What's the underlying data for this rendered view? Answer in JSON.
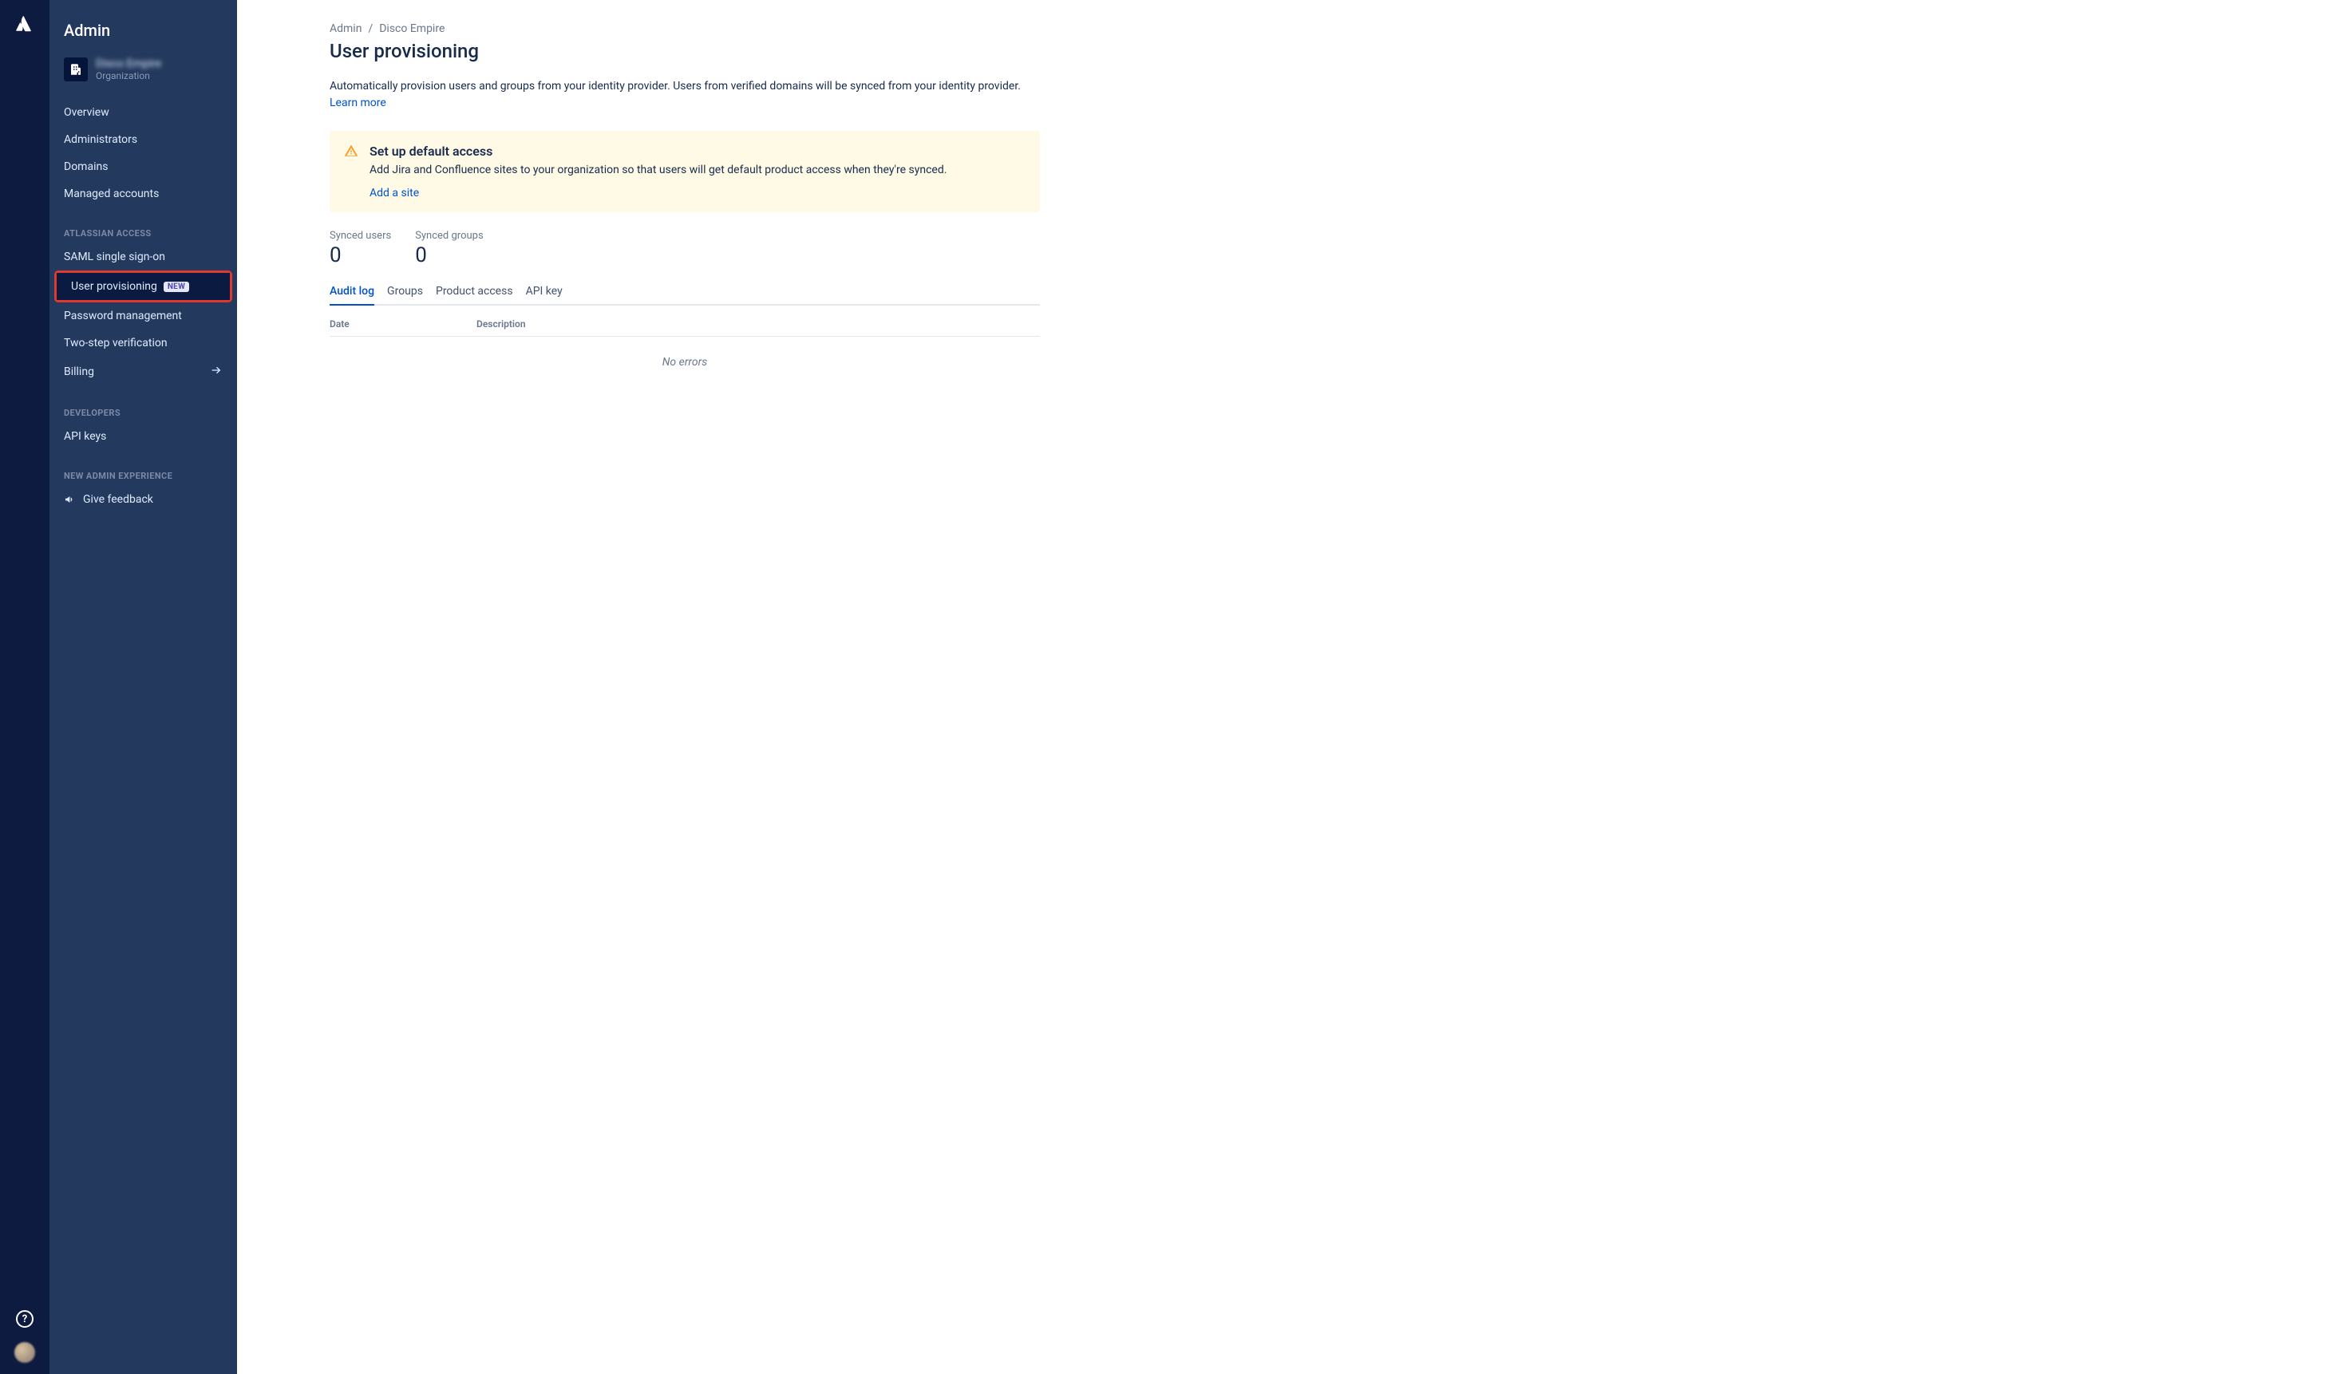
{
  "rail": {
    "help_tooltip": "?"
  },
  "sidebar": {
    "title": "Admin",
    "org": {
      "name": "Disco Empire",
      "subtitle": "Organization"
    },
    "group1": {
      "items": [
        {
          "label": "Overview"
        },
        {
          "label": "Administrators"
        },
        {
          "label": "Domains"
        },
        {
          "label": "Managed accounts"
        }
      ]
    },
    "group2": {
      "heading": "ATLASSIAN ACCESS",
      "items": [
        {
          "label": "SAML single sign-on"
        },
        {
          "label": "User provisioning",
          "badge": "NEW"
        },
        {
          "label": "Password management"
        },
        {
          "label": "Two-step verification"
        },
        {
          "label": "Billing"
        }
      ]
    },
    "group3": {
      "heading": "DEVELOPERS",
      "items": [
        {
          "label": "API keys"
        }
      ]
    },
    "group4": {
      "heading": "NEW ADMIN EXPERIENCE",
      "items": [
        {
          "label": "Give feedback"
        }
      ]
    }
  },
  "main": {
    "breadcrumbs": {
      "root": "Admin",
      "org": "Disco Empire"
    },
    "title": "User provisioning",
    "intro_text": "Automatically provision users and groups from your identity provider. Users from verified domains will be synced from your identity provider.",
    "learn_more": "Learn more",
    "banner": {
      "title": "Set up default access",
      "text": "Add Jira and Confluence sites to your organization so that users will get default product access when they're synced.",
      "link": "Add a site"
    },
    "stats": {
      "synced_users_label": "Synced users",
      "synced_users_value": "0",
      "synced_groups_label": "Synced groups",
      "synced_groups_value": "0"
    },
    "tabs": [
      {
        "label": "Audit log"
      },
      {
        "label": "Groups"
      },
      {
        "label": "Product access"
      },
      {
        "label": "API key"
      }
    ],
    "table": {
      "col_date": "Date",
      "col_desc": "Description",
      "empty": "No errors"
    }
  }
}
